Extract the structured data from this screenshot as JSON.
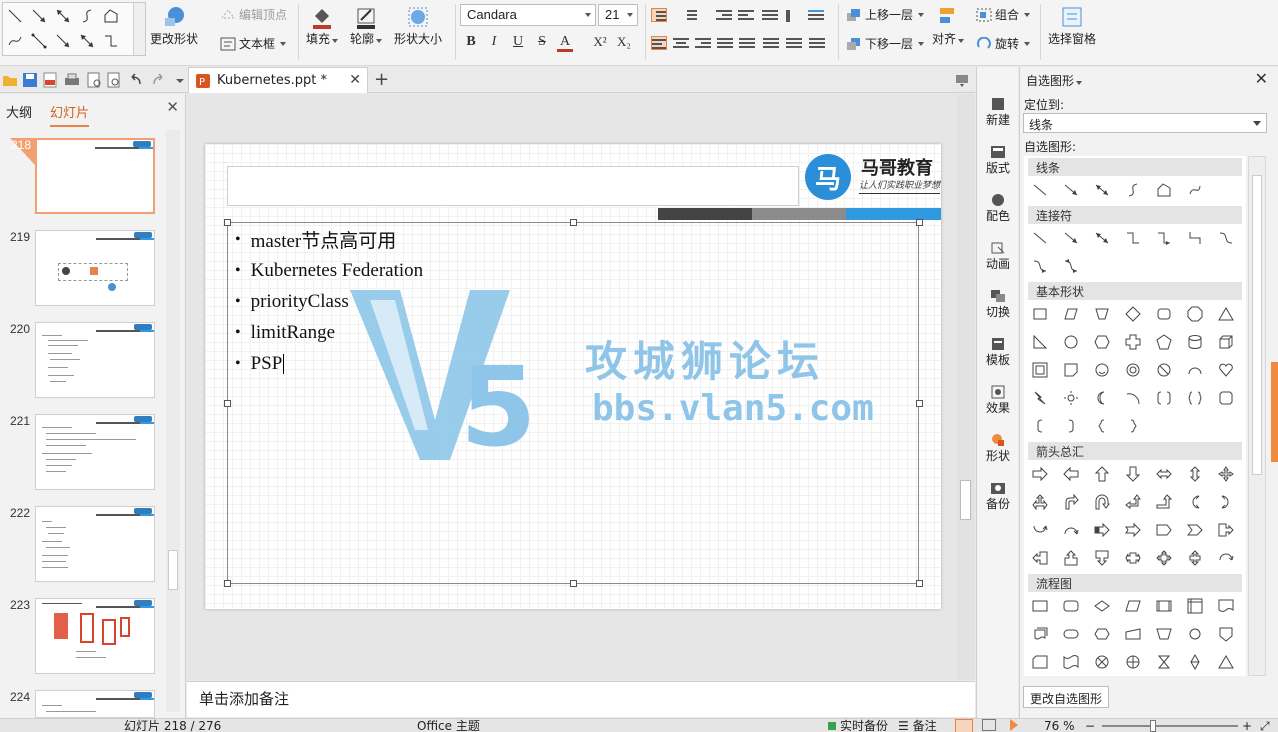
{
  "ribbon": {
    "change_shape": "更改形状",
    "edit_points": "编辑顶点",
    "text_box": "文本框",
    "fill": "填充",
    "outline": "轮廓",
    "shape_size": "形状大小",
    "font_name": "Candara",
    "font_size": "21",
    "bold": "B",
    "italic": "I",
    "underline": "U",
    "strike": "S",
    "font_color": "A",
    "superscript": "X²",
    "subscript": "X₂",
    "bring_forward": "上移一层",
    "send_backward": "下移一层",
    "group": "组合",
    "align": "对齐",
    "rotate": "旋转",
    "selection_pane": "选择窗格"
  },
  "tabbar": {
    "doc_tab_label": "Kubernetes.ppt *",
    "close_glyph": "✕",
    "add_glyph": "+"
  },
  "leftpanel": {
    "tab_outline": "大纲",
    "tab_slides": "幻灯片",
    "close_glyph": "✕",
    "thumbnails": [
      {
        "num": "218"
      },
      {
        "num": "219"
      },
      {
        "num": "220"
      },
      {
        "num": "221"
      },
      {
        "num": "222"
      },
      {
        "num": "223"
      },
      {
        "num": "224"
      }
    ]
  },
  "slide": {
    "logo_glyph": "马",
    "logo_title": "马哥教育",
    "logo_sub": "让人们实践职业梦想",
    "bullets": [
      "master节点高可用",
      "Kubernetes Federation",
      "priorityClass",
      "limitRange",
      "PSP"
    ],
    "colorbar_colors": [
      "#444444",
      "#8c8c8c",
      "#2f9ae0"
    ]
  },
  "watermark": {
    "cn_text": "攻城狮论坛",
    "url_text": "bbs.vlan5.com",
    "color": "#8ec5e8"
  },
  "notes": {
    "placeholder": "单击添加备注"
  },
  "sidetools": {
    "items": [
      "新建",
      "版式",
      "配色",
      "动画",
      "切换",
      "模板",
      "效果",
      "形状",
      "备份"
    ]
  },
  "rightpanel": {
    "title": "自选图形",
    "locate_label": "定位到:",
    "locate_value": "线条",
    "autoshapes_label": "自选图形:",
    "categories": [
      "线条",
      "连接符",
      "基本形状",
      "箭头总汇",
      "流程图"
    ],
    "change_button": "更改自选图形"
  },
  "statusbar": {
    "slide_counter": "幻灯片 218 / 276",
    "theme": "Office 主题",
    "realtime_backup": "实时备份",
    "notes_toggle": "备注",
    "zoom": "76 %"
  },
  "colors": {
    "accent": "#e8834a",
    "brand_blue": "#2a8fd8"
  }
}
